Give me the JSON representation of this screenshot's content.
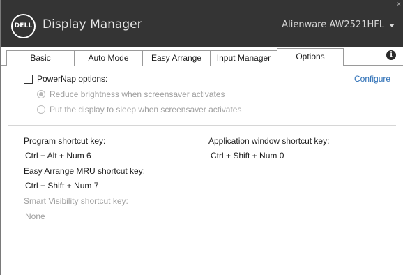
{
  "titlebar": {
    "logo_text": "DELL",
    "app_title": "Display Manager",
    "monitor": "Alienware AW2521HFL",
    "close_glyph": "×"
  },
  "tabs": [
    {
      "label": "Basic"
    },
    {
      "label": "Auto Mode"
    },
    {
      "label": "Easy Arrange"
    },
    {
      "label": "Input Manager"
    },
    {
      "label": "Options",
      "active": true
    }
  ],
  "info_icon": {
    "glyph": "i",
    "icon": "info-icon"
  },
  "options": {
    "powernap": {
      "label": "PowerNap options:",
      "checked": false,
      "configure_label": "Configure",
      "radios": [
        {
          "label": "Reduce brightness when screensaver activates",
          "checked": true,
          "enabled": false
        },
        {
          "label": "Put the display to sleep when screensaver activates",
          "checked": false,
          "enabled": false
        }
      ]
    },
    "shortcuts": {
      "program": {
        "label": "Program shortcut key:",
        "value": "Ctrl + Alt + Num 6"
      },
      "app_window": {
        "label": "Application window shortcut key:",
        "value": "Ctrl + Shift + Num 0"
      },
      "easy_arrange": {
        "label": "Easy Arrange MRU shortcut key:",
        "value": "Ctrl + Shift + Num 7"
      },
      "smart_visibility": {
        "label": "Smart Visibility shortcut key:",
        "value": "None",
        "enabled": false
      }
    }
  },
  "colors": {
    "titlebar_bg": "#343434",
    "link": "#2a6db5",
    "disabled_text": "#a0a0a0"
  }
}
